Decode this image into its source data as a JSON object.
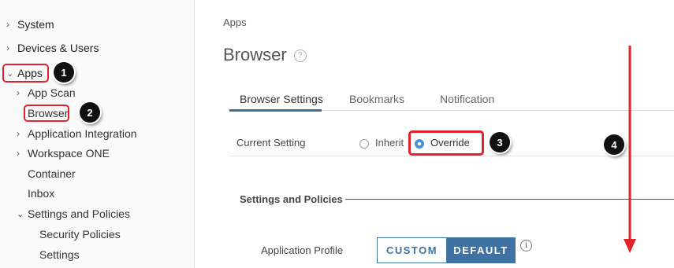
{
  "sidebar": {
    "items": [
      {
        "label": "System"
      },
      {
        "label": "Devices & Users"
      },
      {
        "label": "Apps"
      },
      {
        "label": "App Scan"
      },
      {
        "label": "Browser"
      },
      {
        "label": "Application Integration"
      },
      {
        "label": "Workspace ONE"
      },
      {
        "label": "Container"
      },
      {
        "label": "Inbox"
      },
      {
        "label": "Settings and Policies"
      },
      {
        "label": "Security Policies"
      },
      {
        "label": "Settings"
      }
    ]
  },
  "annotations": {
    "step1": "1",
    "step2": "2",
    "step3": "3",
    "step4": "4",
    "highlight_color": "#e0232b"
  },
  "main": {
    "breadcrumb": "Apps",
    "title": "Browser",
    "tabs": [
      {
        "label": "Browser Settings",
        "active": true
      },
      {
        "label": "Bookmarks",
        "active": false
      },
      {
        "label": "Notification",
        "active": false
      }
    ],
    "current_setting": {
      "label": "Current Setting",
      "options": [
        {
          "label": "Inherit",
          "selected": false
        },
        {
          "label": "Override",
          "selected": true
        }
      ]
    },
    "section_title": "Settings and Policies",
    "app_profile": {
      "label": "Application Profile",
      "options": [
        {
          "label": "CUSTOM",
          "selected": false
        },
        {
          "label": "DEFAULT",
          "selected": true
        }
      ]
    }
  },
  "colors": {
    "accent": "#3f72a4",
    "tab_underline": "#3a6f9e",
    "radio_selected": "#4a90d9"
  }
}
